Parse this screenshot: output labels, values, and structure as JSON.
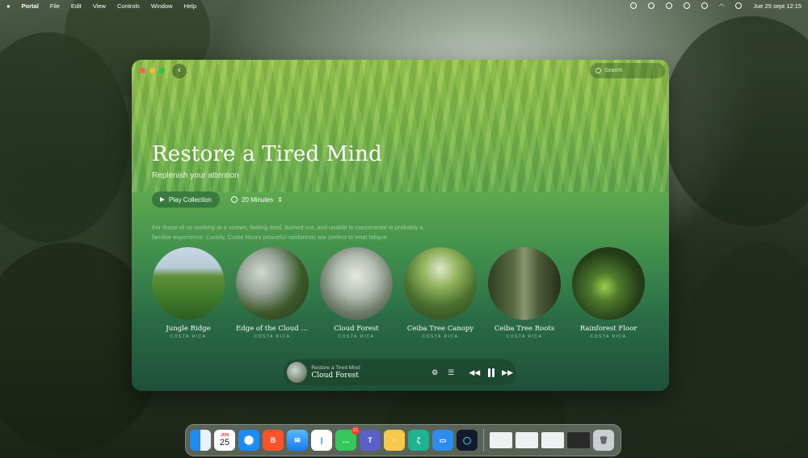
{
  "menubar": {
    "app_name": "Portal",
    "menus": [
      "File",
      "Edit",
      "View",
      "Controls",
      "Window",
      "Help"
    ],
    "datetime": "Jue 25 sept 12:15"
  },
  "window": {
    "search_placeholder": "Search",
    "title": "Restore a Tired Mind",
    "subtitle": "Replenish your attention",
    "play_label": "Play Collection",
    "duration_label": "20 Minutes",
    "description": "For those of us working at a screen, feeling tired, burned out, and unable to concentrate is probably a familiar experience. Luckily, Costa Rica's peaceful rainforests are perfect to treat fatigue"
  },
  "tiles": [
    {
      "name": "Jungle Ridge",
      "place": "COSTA RICA"
    },
    {
      "name": "Edge of the Cloud For…",
      "place": "COSTA RICA"
    },
    {
      "name": "Cloud Forest",
      "place": "COSTA RICA"
    },
    {
      "name": "Ceiba Tree Canopy",
      "place": "COSTA RICA"
    },
    {
      "name": "Ceiba Tree Roots",
      "place": "COSTA RICA"
    },
    {
      "name": "Rainforest Floor",
      "place": "COSTA RICA"
    }
  ],
  "player": {
    "collection": "Restore a Tired Mind",
    "track": "Cloud Forest"
  },
  "dock": {
    "calendar_month": "JUN",
    "calendar_day": "25",
    "messages_badge": "21"
  },
  "colors": {
    "close": "#ff5f57",
    "minimize": "#febc2e",
    "zoom": "#28c840"
  }
}
